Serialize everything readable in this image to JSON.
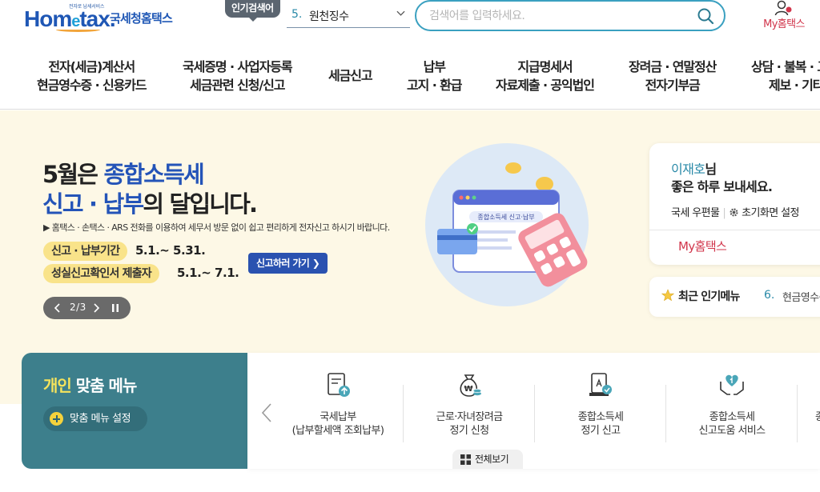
{
  "header": {
    "logo_small": "전자로 납세서비스",
    "logo_brand_pre": "Hom",
    "logo_brand_e": "e",
    "logo_brand_post": "tax.",
    "logo_ko": "국세청홈택스",
    "popular_badge": "인기검색어",
    "popular_num": "5.",
    "popular_text": "원천징수",
    "search_placeholder": "검색어를 입력하세요.",
    "myhome_label": "My홈택스"
  },
  "gnb": {
    "items": [
      {
        "line1": "전자(세금)계산서",
        "line2": "현금영수증 · 신용카드"
      },
      {
        "line1": "국세증명 · 사업자등록",
        "line2": "세금관련 신청/신고"
      },
      {
        "line1": "세금신고",
        "line2": ""
      },
      {
        "line1": "납부",
        "line2": "고지 · 환급"
      },
      {
        "line1": "지급명세서",
        "line2": "자료제출 · 공익법인"
      },
      {
        "line1": "장려금 · 연말정산",
        "line2": "전자기부금"
      },
      {
        "line1": "상담 · 불복 · 고",
        "line2": "제보 · 기타"
      }
    ]
  },
  "banner": {
    "title1_a": "5월은 ",
    "title1_b": "종합소득세",
    "title2_a": "신고 · 납부",
    "title2_b": "의 달입니다.",
    "desc": "▶ 홈택스 · 손택스 · ARS 전화를 이용하여 세무서 방문 없이 쉽고 편리하게 전자신고 하시기 바랍니다.",
    "tag1": "신고 · 납부기간",
    "date1": "5.1.~ 5.31.",
    "tag2": "성실신고확인서 제출자",
    "date2": "5.1.~ 7.1.",
    "cta": "신고하러 가기 ❯",
    "pager": "2/3",
    "illust_label": "종합소득세 신고·납부"
  },
  "user_card": {
    "name": "이재호",
    "suffix": "님",
    "greeting": "좋은 하루 보내세요.",
    "link1": "국세 우편물",
    "link2": "초기화면 설정",
    "myhome": "My홈택스"
  },
  "recent": {
    "label": "최근 인기메뉴",
    "num": "6.",
    "text": "현금영수증"
  },
  "custom_menu": {
    "title_a": "개인",
    "title_b": " 맞춤 메뉴",
    "setting_btn": "맞춤 메뉴 설정",
    "view_all": "전체보기",
    "items": [
      {
        "line1": "국세납부",
        "line2": "(납부할세액 조회납부)",
        "icon": "document-upload-icon"
      },
      {
        "line1": "근로·자녀장려금",
        "line2": "정기 신청",
        "icon": "money-bag-icon"
      },
      {
        "line1": "종합소득세",
        "line2": "정기 신고",
        "icon": "tax-report-icon"
      },
      {
        "line1": "종합소득세",
        "line2": "신고도움 서비스",
        "icon": "heart-hands-icon"
      },
      {
        "line1": "종",
        "line2": "",
        "icon": "partial-icon"
      }
    ]
  },
  "colors": {
    "brand_blue": "#1f57b5",
    "accent_teal": "#3d7f8c",
    "banner_bg": "#fdf8e6",
    "myhome_red": "#d1354b",
    "search_border": "#3aa0c0"
  }
}
